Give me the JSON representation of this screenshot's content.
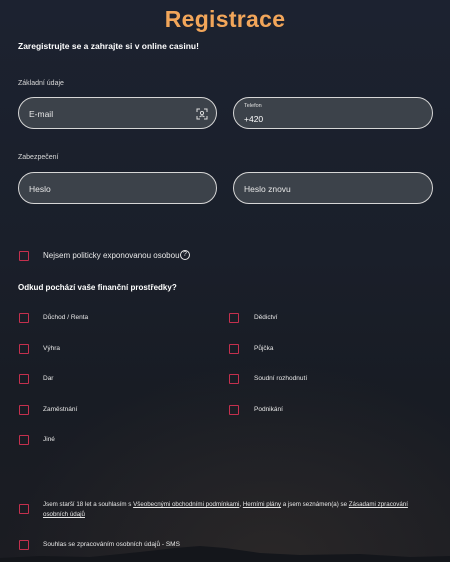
{
  "header": {
    "title": "Registrace",
    "subtitle": "Zaregistrujte se a zahrajte si v online casinu!"
  },
  "basic": {
    "section_label": "Základní údaje",
    "email_placeholder": "E-mail",
    "phone_label": "Telefon",
    "phone_value": "+420"
  },
  "security": {
    "section_label": "Zabezpečení",
    "password_placeholder": "Heslo",
    "password_repeat_placeholder": "Heslo znovu"
  },
  "pep": {
    "label": "Nejsem politicky exponovanou osobou",
    "help_glyph": "?"
  },
  "funds": {
    "question": "Odkud pochází vaše finanční prostředky?",
    "options": [
      "Důchod / Renta",
      "Dědictví",
      "Výhra",
      "Půjčka",
      "Dar",
      "Soudní rozhodnutí",
      "Zaměstnání",
      "Podnikání",
      "Jiné"
    ]
  },
  "consents": {
    "terms": {
      "prefix": "Jsem starší 18 let a souhlasím s ",
      "link1": "Všeobecnými obchodními podmínkami",
      "sep1": ", ",
      "link2": "Herními plány",
      "mid": " a jsem seznámen(a) se ",
      "link3": "Zásadami zpracování osobních údajů"
    },
    "sms": "Souhlas se zpracováním osobních údajů - SMS"
  },
  "colors": {
    "title_accent": "#f2a65a",
    "checkbox_border": "#c4304e",
    "field_bg": "#3c424a"
  }
}
